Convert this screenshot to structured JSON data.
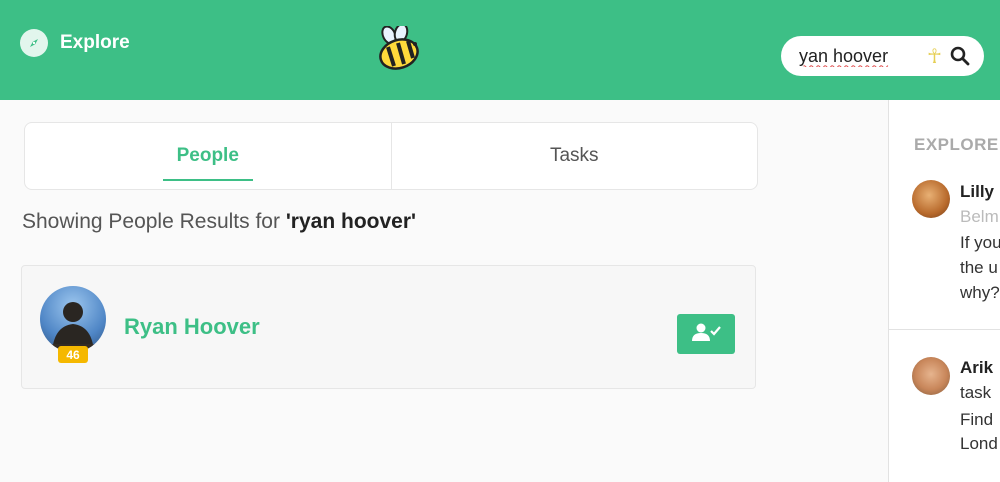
{
  "header": {
    "explore_label": "Explore",
    "logo_icon": "bee-icon",
    "search": {
      "value": "yan hoover",
      "icon": "search-icon"
    }
  },
  "colors": {
    "brand": "#3dbf86",
    "badge": "#f5b800"
  },
  "tabs": [
    {
      "label": "People",
      "active": true
    },
    {
      "label": "Tasks",
      "active": false
    }
  ],
  "results": {
    "prefix": "Showing People Results for ",
    "query": "'ryan hoover'"
  },
  "person": {
    "name": "Ryan Hoover",
    "badge": "46",
    "follow_icon": "user-check-icon"
  },
  "sidebar": {
    "title": "EXPLORE",
    "items": [
      {
        "name": "Lilly",
        "sub": "Belm",
        "lines": [
          "If you",
          "the u",
          "why?"
        ]
      },
      {
        "name": "Arik",
        "sub": "task",
        "lines": [
          "Find",
          "Lond"
        ]
      }
    ]
  }
}
